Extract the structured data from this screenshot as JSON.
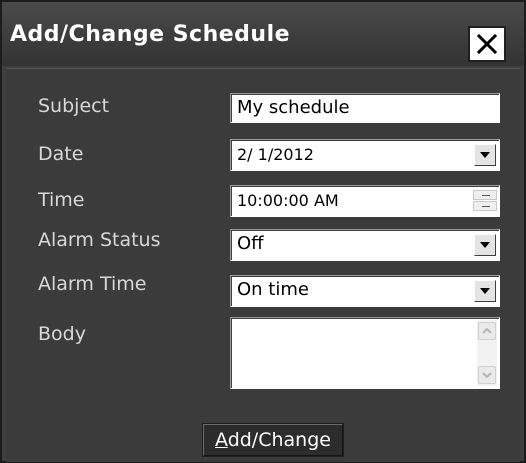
{
  "window": {
    "title": "Add/Change Schedule",
    "close_icon": "close-x-icon"
  },
  "form": {
    "subject_label": "Subject",
    "subject_value": "My schedule",
    "date_label": "Date",
    "date_value": "2/ 1/2012",
    "time_label": "Time",
    "time_value": "10:00:00 AM",
    "alarm_status_label": "Alarm Status",
    "alarm_status_value": "Off",
    "alarm_time_label": "Alarm Time",
    "alarm_time_value": "On time",
    "body_label": "Body",
    "body_value": ""
  },
  "actions": {
    "submit_mnemonic": "A",
    "submit_rest": "dd/Change"
  },
  "colors": {
    "dialog_bg": "#3b3b3b",
    "titlebar_bg": "#3f3f3f",
    "label_text": "#d8d8d8",
    "field_bg": "#ffffff"
  }
}
